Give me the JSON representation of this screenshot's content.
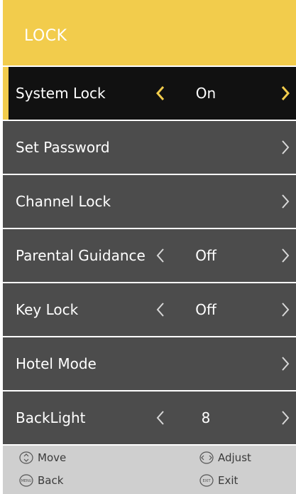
{
  "header": {
    "title": "LOCK"
  },
  "menu": {
    "items": [
      {
        "label": "System Lock",
        "value": "On"
      },
      {
        "label": "Set Password",
        "value": ""
      },
      {
        "label": "Channel Lock",
        "value": ""
      },
      {
        "label": "Parental Guidance",
        "value": "Off"
      },
      {
        "label": "Key Lock",
        "value": "Off"
      },
      {
        "label": "Hotel Mode",
        "value": ""
      },
      {
        "label": "BackLight",
        "value": "8"
      }
    ]
  },
  "footer": {
    "move": "Move",
    "adjust": "Adjust",
    "back": "Back",
    "exit": "Exit",
    "menu_key": "MENU",
    "exit_key": "EXIT"
  },
  "colors": {
    "accent": "#f2cc4c",
    "selected_row": "#111111",
    "row": "#4c4c4c",
    "footer": "#cfcfcf"
  }
}
